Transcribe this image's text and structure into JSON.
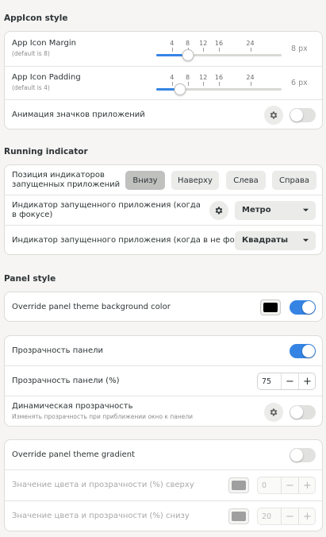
{
  "appicon": {
    "title": "AppIcon style",
    "margin": {
      "label": "App Icon Margin",
      "sub": "(default is 8)",
      "value_text": "8 px",
      "value": 8,
      "min": 0,
      "max": 32
    },
    "padding": {
      "label": "App Icon Padding",
      "sub": "(default is 4)",
      "value_text": "6 px",
      "value": 6,
      "min": 0,
      "max": 32
    },
    "ticks": [
      "4",
      "8",
      "12",
      "16",
      "24"
    ],
    "animation": {
      "label": "Анимация значков приложений",
      "enabled": false
    }
  },
  "running": {
    "title": "Running indicator",
    "position": {
      "label": "Позиция индикаторов запущенных приложений",
      "options": [
        "Внизу",
        "Наверху",
        "Слева",
        "Справа"
      ],
      "selected": "Внизу"
    },
    "focused": {
      "label": "Индикатор запущенного приложения (когда в фокусе)",
      "value": "Метро"
    },
    "unfocused": {
      "label": "Индикатор запущенного приложения (когда в не фокусе)",
      "value": "Квадраты"
    }
  },
  "panel": {
    "title": "Panel style",
    "override_bg": {
      "label": "Override panel theme background color",
      "enabled": true,
      "color": "#000000"
    },
    "transparency": {
      "label": "Прозрачность панели",
      "enabled": true
    },
    "transparency_pct": {
      "label": "Прозрачность панели (%)",
      "value": "75",
      "minus": "−",
      "plus": "+"
    },
    "dynamic": {
      "label": "Динамическая прозрачность",
      "sub": "Изменять прозрачность при приближении окно к панели",
      "enabled": false
    },
    "gradient": {
      "label": "Override panel theme gradient",
      "enabled": false
    },
    "top": {
      "label": "Значение цвета и прозрачности (%) сверху",
      "value": "0",
      "color": "#808080",
      "minus": "−",
      "plus": "+"
    },
    "bottom": {
      "label": "Значение цвета и прозрачности (%) снизу",
      "value": "20",
      "color": "#808080",
      "minus": "−",
      "plus": "+"
    }
  },
  "colors": {
    "accent": "#3584e4"
  }
}
